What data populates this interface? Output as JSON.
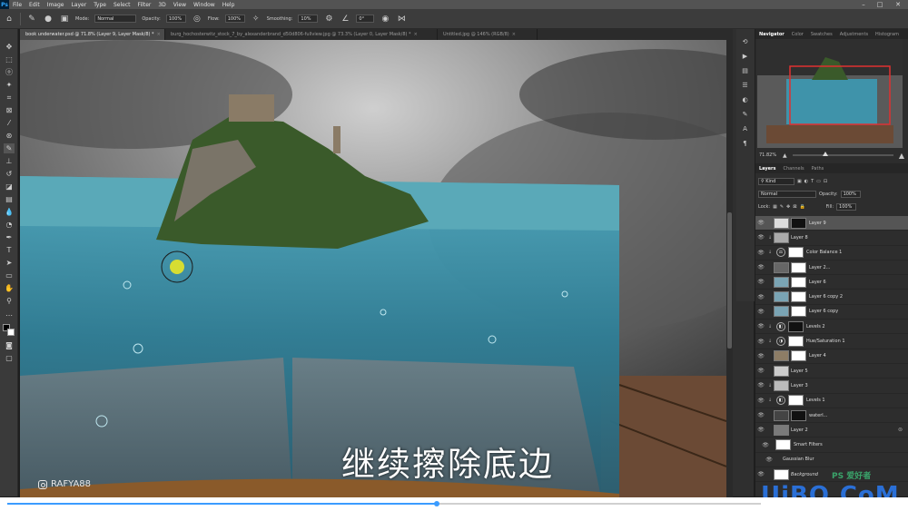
{
  "menubar": {
    "items": [
      "File",
      "Edit",
      "Image",
      "Layer",
      "Type",
      "Select",
      "Filter",
      "3D",
      "View",
      "Window",
      "Help"
    ]
  },
  "options": {
    "mode_label": "Mode:",
    "mode_value": "Normal",
    "opacity_label": "Opacity:",
    "opacity_value": "100%",
    "flow_label": "Flow:",
    "flow_value": "100%",
    "smoothing_label": "Smoothing:",
    "smoothing_value": "10%",
    "angle_value": "0°"
  },
  "tabs": [
    {
      "label": "book underwater.psd @ 71.8% (Layer 9, Layer Mask/8) *",
      "active": true
    },
    {
      "label": "burg_hochosterwitz_stock_7_by_alexanderbrand_d50d806-fullview.jpg @ 73.3% (Layer 0, Layer Mask/8) *",
      "active": false
    },
    {
      "label": "Untitled.jpg @ 146% (RGB/8)",
      "active": false
    }
  ],
  "navigator": {
    "tabs": [
      "Navigator",
      "Color",
      "Swatches",
      "Adjustments",
      "Histogram"
    ],
    "zoom": "71.82%"
  },
  "layers_panel": {
    "tabs": [
      "Layers",
      "Channels",
      "Paths"
    ],
    "filter_kind": "Kind",
    "blend_mode": "Normal",
    "opacity_label": "Opacity:",
    "opacity_value": "100%",
    "lock_label": "Lock:",
    "fill_label": "Fill:",
    "fill_value": "100%",
    "layers": [
      {
        "name": "Layer 9",
        "selected": true,
        "mask": true,
        "type": "pixel"
      },
      {
        "name": "Layer 8",
        "selected": false,
        "mask": false,
        "type": "pixel",
        "clipped": true
      },
      {
        "name": "Color Balance 1",
        "selected": false,
        "mask": true,
        "type": "adjustment"
      },
      {
        "name": "Layer 2...",
        "selected": false,
        "mask": true,
        "type": "pixel"
      },
      {
        "name": "Layer 6",
        "selected": false,
        "mask": true,
        "type": "pixel"
      },
      {
        "name": "Layer 6 copy 2",
        "selected": false,
        "mask": true,
        "type": "pixel"
      },
      {
        "name": "Layer 6 copy",
        "selected": false,
        "mask": true,
        "type": "pixel"
      },
      {
        "name": "Levels 2",
        "selected": false,
        "mask": true,
        "type": "adjustment"
      },
      {
        "name": "Hue/Saturation 1",
        "selected": false,
        "mask": true,
        "type": "adjustment"
      },
      {
        "name": "Layer 4",
        "selected": false,
        "mask": true,
        "type": "pixel"
      },
      {
        "name": "Layer 5",
        "selected": false,
        "mask": false,
        "type": "pixel"
      },
      {
        "name": "Layer 3",
        "selected": false,
        "mask": false,
        "type": "pixel",
        "clipped": true
      },
      {
        "name": "Levels 1",
        "selected": false,
        "mask": true,
        "type": "adjustment"
      },
      {
        "name": "waterl...",
        "selected": false,
        "mask": true,
        "type": "pixel"
      },
      {
        "name": "Layer 2",
        "selected": false,
        "mask": false,
        "type": "smart"
      },
      {
        "name": "Smart Filters",
        "selected": false,
        "mask": true,
        "type": "filter"
      },
      {
        "name": "Gaussian Blur",
        "selected": false,
        "mask": false,
        "type": "filter-item"
      },
      {
        "name": "Background",
        "selected": false,
        "mask": false,
        "type": "background"
      }
    ]
  },
  "video": {
    "progress": 0.57,
    "buffered": 0.58
  },
  "overlay": {
    "subtitle": "继续擦除底边",
    "instagram_handle": "RAFYA88",
    "site_watermark": "UiBQ.CoM",
    "ps_watermark": "PS 爱好者"
  },
  "colors": {
    "accent": "#31a8ff",
    "water": "#3a8fa8",
    "sky": "#6b6b6b",
    "selected_layer": "#555555"
  }
}
